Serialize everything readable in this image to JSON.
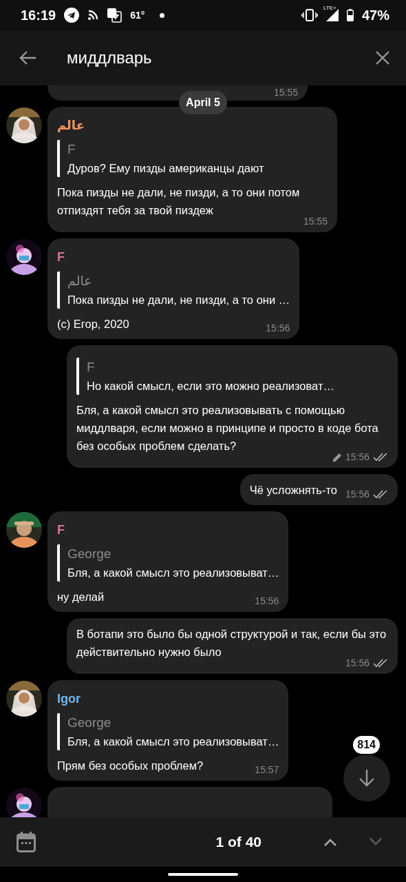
{
  "status_bar": {
    "time": "16:19",
    "temperature": "61°",
    "network": "LTE+",
    "battery": "47%"
  },
  "search": {
    "value": "миддлварь"
  },
  "date_pill": "April 5",
  "messages": [
    {
      "kind": "cut",
      "time": "15:55"
    },
    {
      "kind": "incoming",
      "name": "عالم",
      "color": "#f4955c",
      "reply": {
        "name": "F",
        "text": "Дуров? Ему пизды американцы дают"
      },
      "text": "Пока пизды не дали, не пизди, а то они потом отпиздят тебя за твой пиздеж",
      "time": "15:55"
    },
    {
      "kind": "incoming",
      "name": "F",
      "color": "#e2709c",
      "reply": {
        "name": "عالم",
        "text": "Пока пизды не дали, не пизди, а то они …"
      },
      "text": "(с) Егор, 2020",
      "time": "15:56"
    },
    {
      "kind": "outgoing",
      "reply": {
        "name": "F",
        "text": "Но какой смысл, если это можно реализоват…"
      },
      "text": "Бля, а какой смысл это реализовывать с помощью миддлваря, если можно в принципе и просто в коде бота без особых проблем сделать?",
      "edited": true,
      "read": true,
      "time": "15:56"
    },
    {
      "kind": "outgoing",
      "text": "Чё усложнять-то",
      "edited": false,
      "read": true,
      "time": "15:56"
    },
    {
      "kind": "incoming",
      "name": "F",
      "color": "#e2709c",
      "reply": {
        "name": "George",
        "text": "Бля, а какой смысл это реализовыват…"
      },
      "text": "ну делай",
      "time": "15:56"
    },
    {
      "kind": "outgoing",
      "text": "В ботапи это было бы одной структурой и так, если бы это действительно нужно было",
      "edited": false,
      "read": true,
      "time": "15:56"
    },
    {
      "kind": "incoming",
      "name": "Igor",
      "color": "#72b8f2",
      "reply": {
        "name": "George",
        "text": "Бля, а какой смысл это реализовыват…"
      },
      "text": "Прям без особых проблем?",
      "time": "15:57"
    },
    {
      "kind": "incoming_cut"
    }
  ],
  "scroll_badge": "814",
  "bottom_bar": {
    "counter": "1 of 40",
    "up_disabled": false,
    "down_disabled": true
  }
}
